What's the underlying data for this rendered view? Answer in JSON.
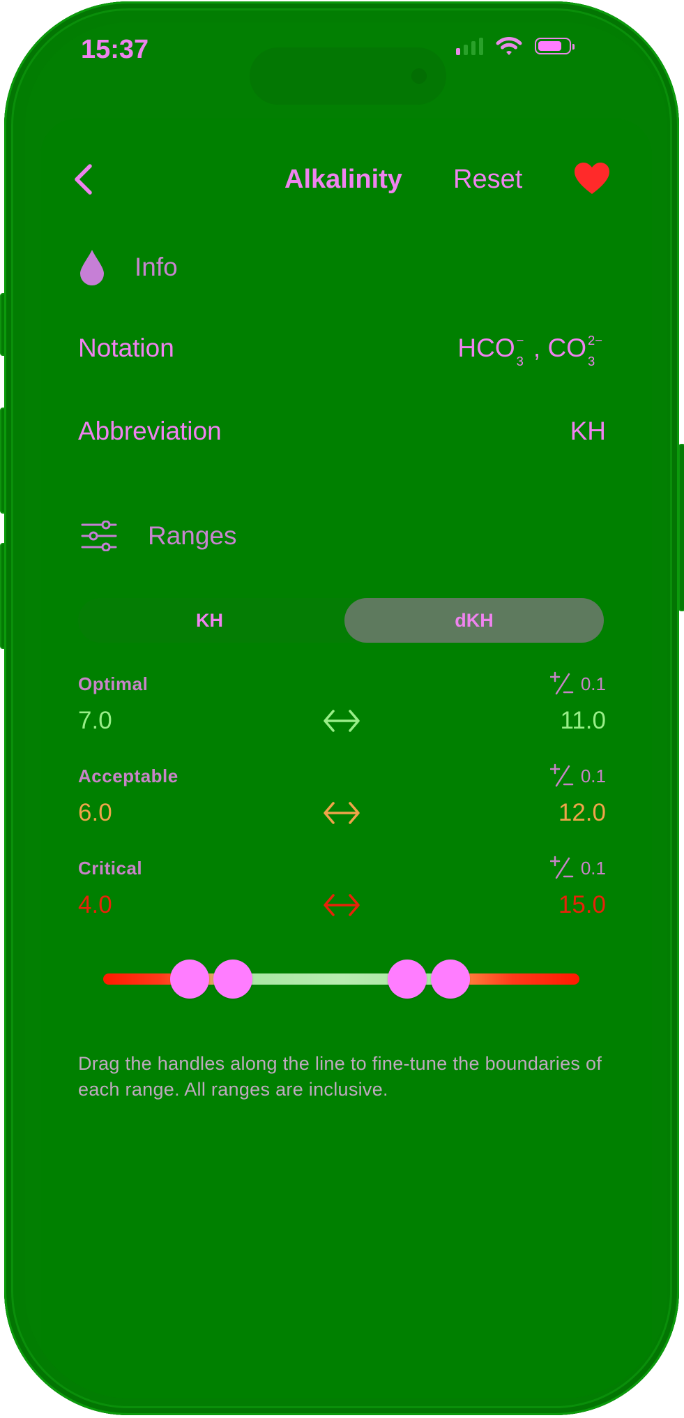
{
  "status_bar": {
    "time": "15:37"
  },
  "nav": {
    "title": "Alkalinity",
    "reset_label": "Reset"
  },
  "info_section": {
    "title": "Info",
    "notation_label": "Notation",
    "notation_part1": "HCO",
    "notation_sub1": "3",
    "notation_sup1": "−",
    "notation_sep": " , ",
    "notation_part2": "CO",
    "notation_sub2": "3",
    "notation_sup2": "2−",
    "abbreviation_label": "Abbreviation",
    "abbreviation_value": "KH"
  },
  "ranges_section": {
    "title": "Ranges",
    "units": [
      "KH",
      "dKH"
    ],
    "selected_unit": "dKH",
    "ranges": [
      {
        "name": "Optimal",
        "min": "7.0",
        "max": "11.0",
        "tolerance": "0.1",
        "color": "#99ee88"
      },
      {
        "name": "Acceptable",
        "min": "6.0",
        "max": "12.0",
        "tolerance": "0.1",
        "color": "#f0a44a"
      },
      {
        "name": "Critical",
        "min": "4.0",
        "max": "15.0",
        "tolerance": "0.1",
        "color": "#e8220a"
      }
    ],
    "help_text": "Drag the handles along the line to fine-tune the boundaries of each range. All ranges are inclusive."
  },
  "colors": {
    "accent": "#ef83ef",
    "background": "#008000",
    "heart": "#ff2a2a"
  }
}
